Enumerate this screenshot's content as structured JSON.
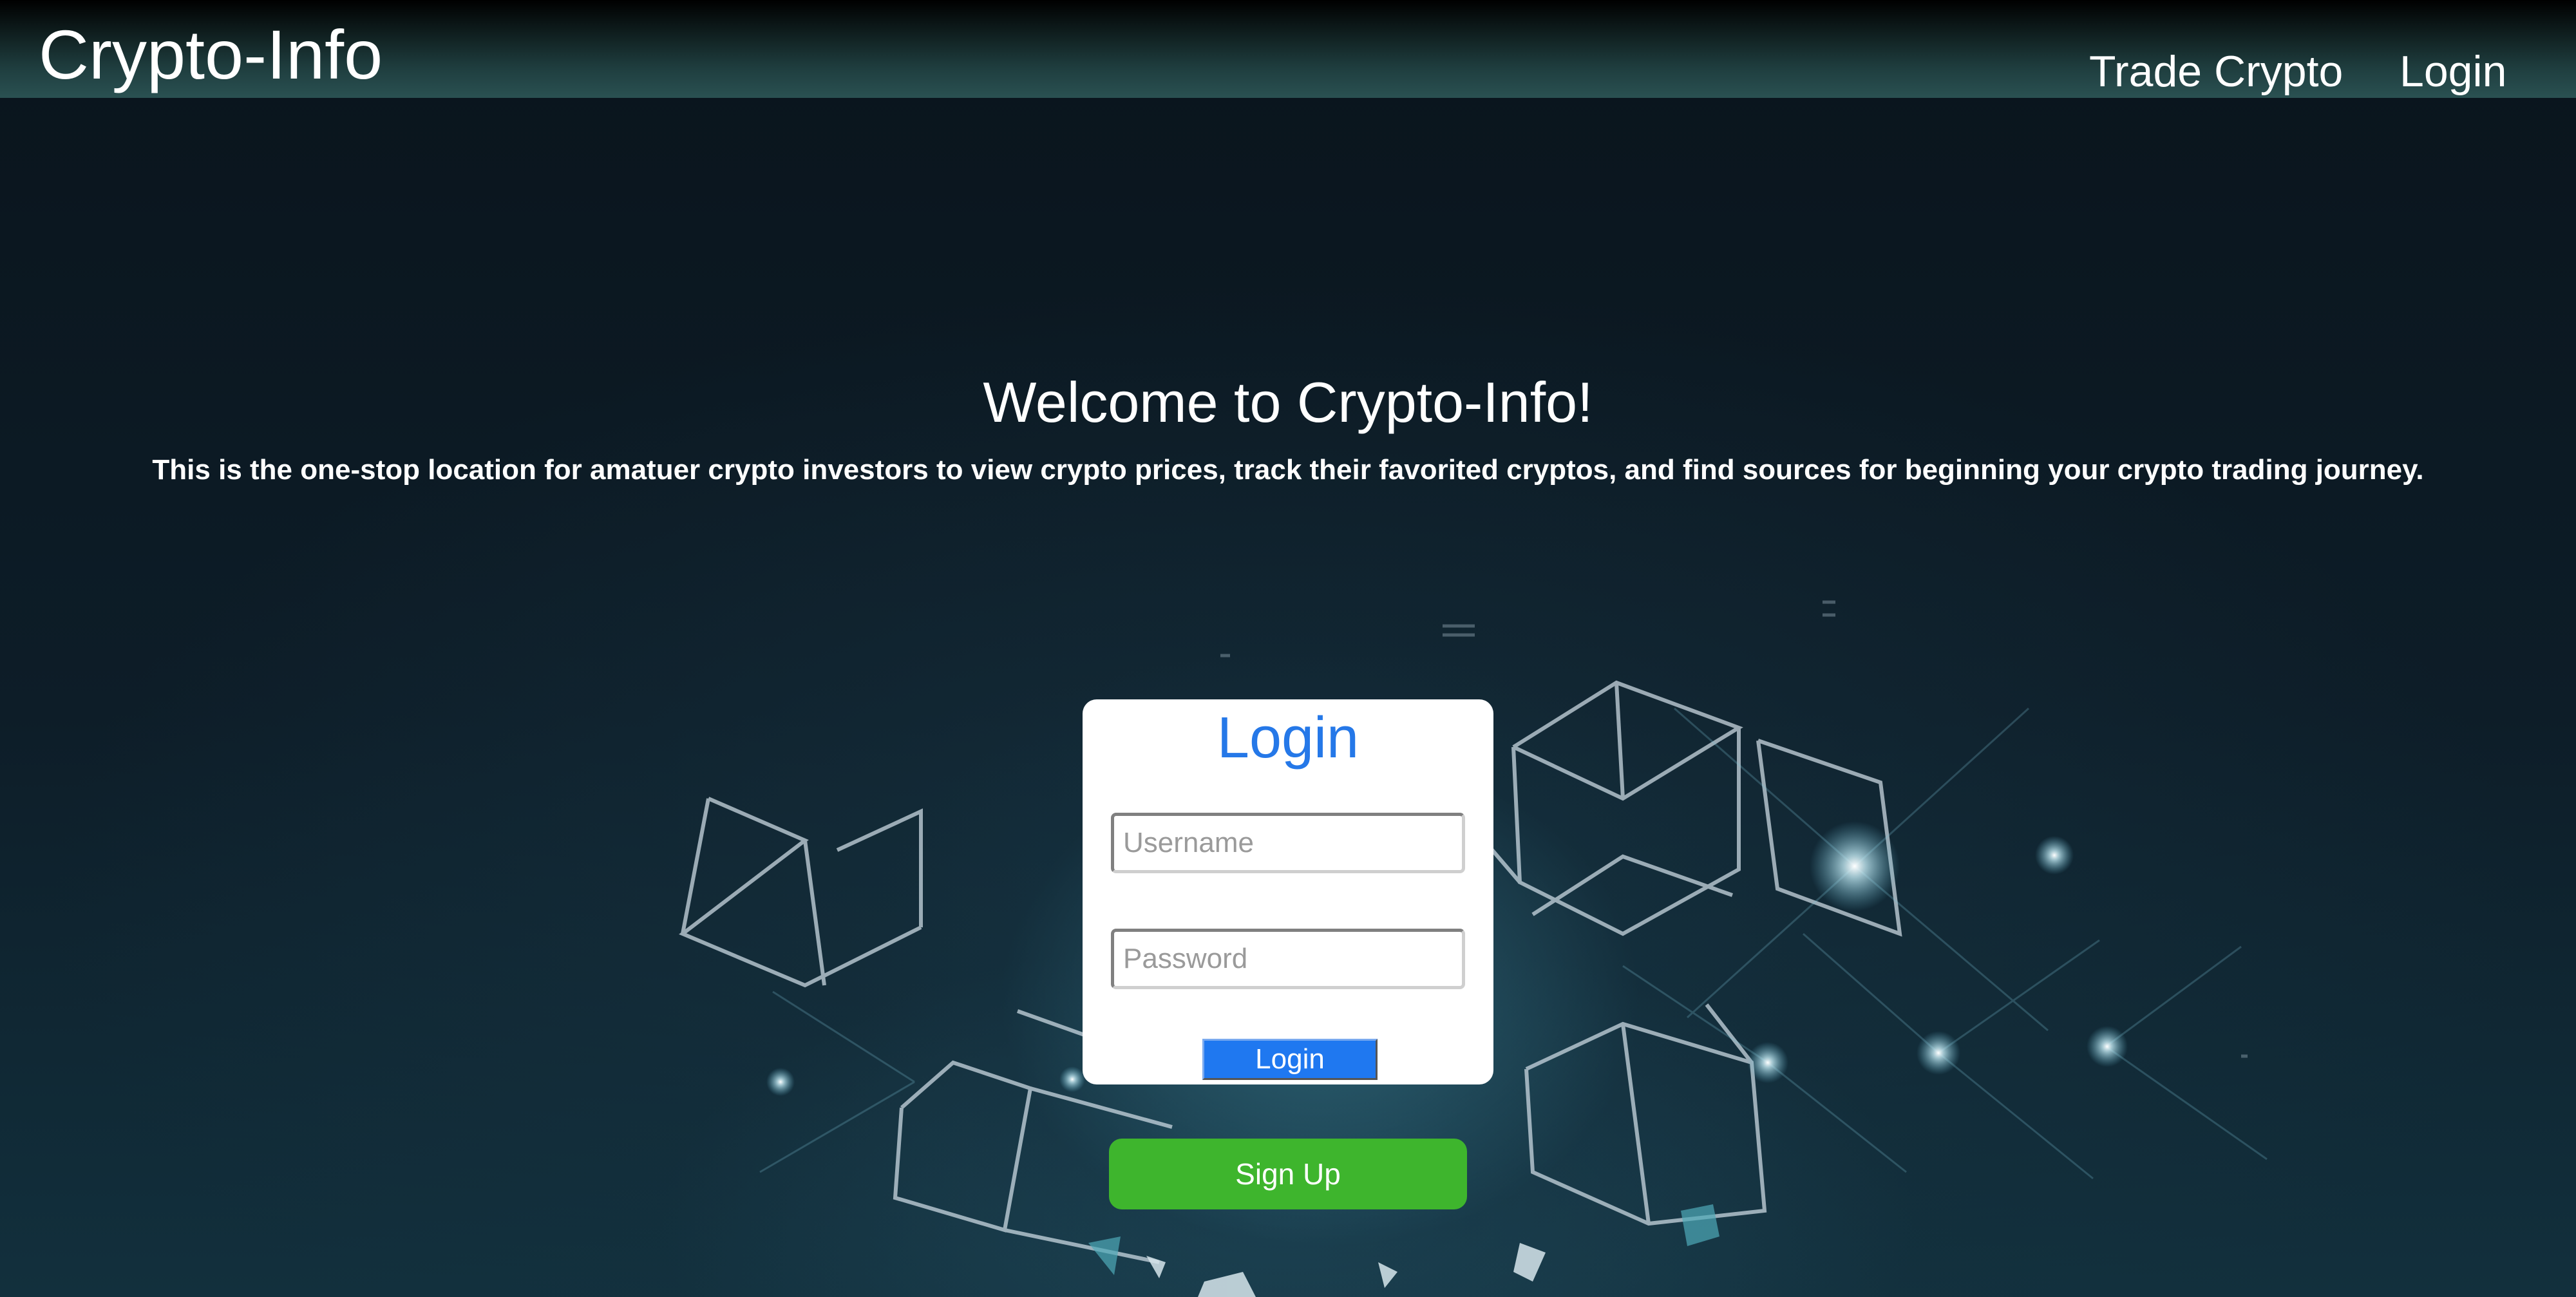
{
  "navbar": {
    "brand": "Crypto-Info",
    "links": [
      {
        "label": "Trade Crypto"
      },
      {
        "label": "Login"
      }
    ]
  },
  "hero": {
    "title": "Welcome to Crypto-Info!",
    "subtitle": "This is the one-stop location for amatuer crypto investors to view crypto prices, track their favorited cryptos, and find sources for beginning your crypto trading journey."
  },
  "login_form": {
    "title": "Login",
    "username_placeholder": "Username",
    "username_value": "",
    "password_placeholder": "Password",
    "password_value": "",
    "submit_label": "Login"
  },
  "signup": {
    "label": "Sign Up"
  },
  "colors": {
    "accent_blue": "#2578e8",
    "signup_green": "#3eb52d",
    "navbar_teal": "#2a5152"
  }
}
